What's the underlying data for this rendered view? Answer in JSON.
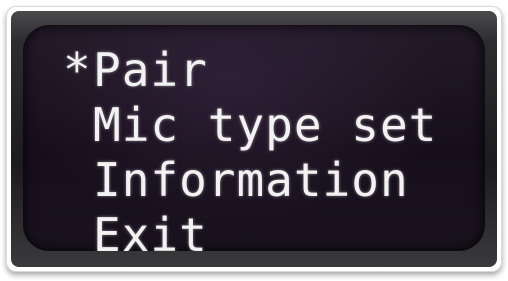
{
  "screen": {
    "cursor_symbol": "*",
    "menu": [
      {
        "label": "Pair",
        "selected": true
      },
      {
        "label": "Mic type set",
        "selected": false
      },
      {
        "label": "Information",
        "selected": false
      },
      {
        "label": "Exit",
        "selected": false
      }
    ]
  },
  "colors": {
    "text": "#f2f2f2",
    "screen_background": "#1a131f"
  }
}
